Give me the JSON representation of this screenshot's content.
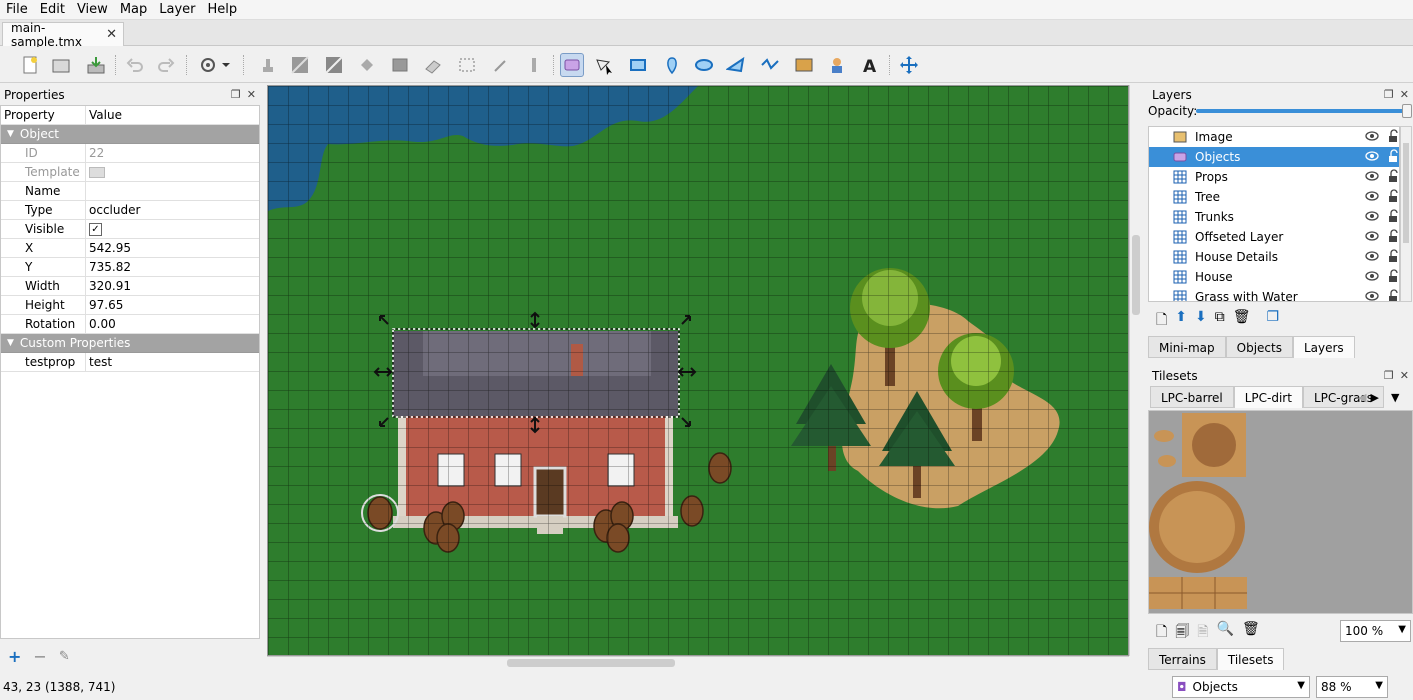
{
  "menu": [
    "File",
    "Edit",
    "View",
    "Map",
    "Layer",
    "Help"
  ],
  "document_tab": {
    "title": "main-sample.tmx",
    "close": "✕"
  },
  "properties": {
    "panel_title": "Properties",
    "col_property": "Property",
    "col_value": "Value",
    "object_group": "Object",
    "rows": [
      {
        "key": "ID",
        "value": "22",
        "dim": true
      },
      {
        "key": "Template",
        "value": "",
        "dim": true
      },
      {
        "key": "Name",
        "value": ""
      },
      {
        "key": "Type",
        "value": "occluder"
      },
      {
        "key": "Visible",
        "value": "✓"
      },
      {
        "key": "X",
        "value": "542.95"
      },
      {
        "key": "Y",
        "value": "735.82"
      },
      {
        "key": "Width",
        "value": "320.91"
      },
      {
        "key": "Height",
        "value": "97.65"
      },
      {
        "key": "Rotation",
        "value": "0.00"
      }
    ],
    "custom_group": "Custom Properties",
    "custom_rows": [
      {
        "key": "testprop",
        "value": "test"
      }
    ]
  },
  "layers": {
    "panel_title": "Layers",
    "opacity_label": "Opacity:",
    "opacity_value": 1.0,
    "items": [
      {
        "name": "Image",
        "type": "image"
      },
      {
        "name": "Objects",
        "type": "object",
        "selected": true
      },
      {
        "name": "Props",
        "type": "tile"
      },
      {
        "name": "Tree",
        "type": "tile"
      },
      {
        "name": "Trunks",
        "type": "tile"
      },
      {
        "name": "Offseted Layer",
        "type": "tile"
      },
      {
        "name": "House Details",
        "type": "tile"
      },
      {
        "name": "House",
        "type": "tile"
      },
      {
        "name": "Grass with Water",
        "type": "tile"
      }
    ],
    "tabs": [
      "Mini-map",
      "Objects",
      "Layers"
    ]
  },
  "tilesets": {
    "panel_title": "Tilesets",
    "tabs": [
      "LPC-barrel",
      "LPC-dirt",
      "LPC-grass"
    ],
    "zoom": "100 %",
    "bottom_tabs": [
      "Terrains",
      "Tilesets"
    ]
  },
  "status": {
    "coords": "43, 23 (1388, 741)",
    "layer_combo": "Objects",
    "zoom": "88 %"
  },
  "colors": {
    "grass": "#2e7d2d",
    "water": "#1f5f8b",
    "selection": "#3a8fd8"
  }
}
